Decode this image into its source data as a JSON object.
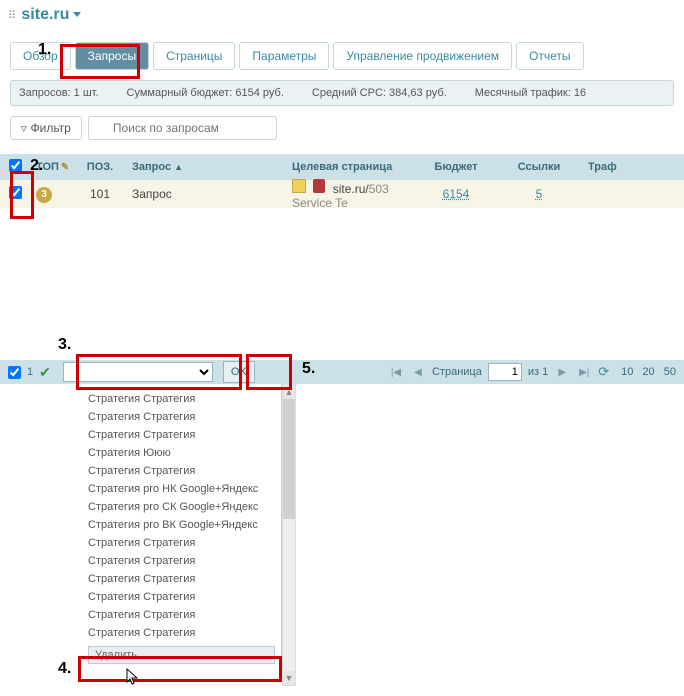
{
  "domain": "Computer-Use",
  "header": {
    "site_name": "site.ru"
  },
  "tabs": {
    "overview": "Обзор",
    "queries": "Запросы",
    "pages": "Страницы",
    "params": "Параметры",
    "promo": "Управление продвижением",
    "reports": "Отчеты",
    "active": "queries"
  },
  "stats": {
    "count": "Запросов: 1 шт.",
    "budget": "Суммарный бюджет: 6154 руб.",
    "cpc": "Средний CPC: 384,63 руб.",
    "traffic": "Месячный трафик: 16"
  },
  "filter": {
    "button": "Фильтр",
    "placeholder": "Поиск по запросам"
  },
  "columns": {
    "top": "ТОП",
    "pos": "ПОЗ.",
    "query": "Запрос",
    "target": "Целевая страница",
    "budget": "Бюджет",
    "links": "Ссылки",
    "traffic": "Траф"
  },
  "row": {
    "top_badge": "3",
    "pos": "101",
    "query": "Запрос",
    "target_prefix": "site.ru/",
    "target_suffix": "503 Service Te",
    "budget": "6154",
    "links": "5"
  },
  "footer": {
    "selected_count": "1",
    "action_placeholder": "",
    "ok": "OK",
    "page_label": "Страница",
    "page_value": "1",
    "page_total": "из 1",
    "page_sizes": [
      "10",
      "20",
      "50"
    ]
  },
  "dropdown": {
    "items": [
      "Стратегия Стратегия",
      "Стратегия Стратегия",
      "Стратегия Стратегия",
      "Стратегия Ююю",
      "Стратегия Стратегия",
      "Стратегия pro НК Google+Яндекс",
      "Стратегия pro СК Google+Яндекс",
      "Стратегия pro ВК Google+Яндекс",
      "Стратегия Стратегия",
      "Стратегия Стратегия",
      "Стратегия Стратегия",
      "Стратегия Стратегия",
      "Стратегия Стратегия",
      "Стратегия Стратегия"
    ],
    "delete": "Удалить"
  },
  "annotations": {
    "n1": "1.",
    "n2": "2.",
    "n3": "3.",
    "n4": "4.",
    "n5": "5."
  }
}
